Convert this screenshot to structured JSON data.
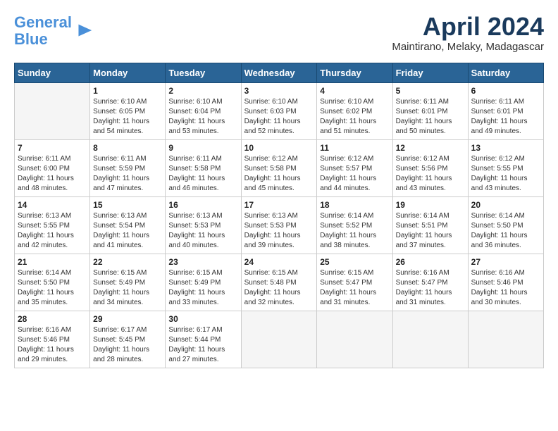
{
  "logo": {
    "line1": "General",
    "line2": "Blue"
  },
  "title": "April 2024",
  "subtitle": "Maintirano, Melaky, Madagascar",
  "weekdays": [
    "Sunday",
    "Monday",
    "Tuesday",
    "Wednesday",
    "Thursday",
    "Friday",
    "Saturday"
  ],
  "weeks": [
    [
      {
        "day": "",
        "info": ""
      },
      {
        "day": "1",
        "info": "Sunrise: 6:10 AM\nSunset: 6:05 PM\nDaylight: 11 hours\nand 54 minutes."
      },
      {
        "day": "2",
        "info": "Sunrise: 6:10 AM\nSunset: 6:04 PM\nDaylight: 11 hours\nand 53 minutes."
      },
      {
        "day": "3",
        "info": "Sunrise: 6:10 AM\nSunset: 6:03 PM\nDaylight: 11 hours\nand 52 minutes."
      },
      {
        "day": "4",
        "info": "Sunrise: 6:10 AM\nSunset: 6:02 PM\nDaylight: 11 hours\nand 51 minutes."
      },
      {
        "day": "5",
        "info": "Sunrise: 6:11 AM\nSunset: 6:01 PM\nDaylight: 11 hours\nand 50 minutes."
      },
      {
        "day": "6",
        "info": "Sunrise: 6:11 AM\nSunset: 6:01 PM\nDaylight: 11 hours\nand 49 minutes."
      }
    ],
    [
      {
        "day": "7",
        "info": "Sunrise: 6:11 AM\nSunset: 6:00 PM\nDaylight: 11 hours\nand 48 minutes."
      },
      {
        "day": "8",
        "info": "Sunrise: 6:11 AM\nSunset: 5:59 PM\nDaylight: 11 hours\nand 47 minutes."
      },
      {
        "day": "9",
        "info": "Sunrise: 6:11 AM\nSunset: 5:58 PM\nDaylight: 11 hours\nand 46 minutes."
      },
      {
        "day": "10",
        "info": "Sunrise: 6:12 AM\nSunset: 5:58 PM\nDaylight: 11 hours\nand 45 minutes."
      },
      {
        "day": "11",
        "info": "Sunrise: 6:12 AM\nSunset: 5:57 PM\nDaylight: 11 hours\nand 44 minutes."
      },
      {
        "day": "12",
        "info": "Sunrise: 6:12 AM\nSunset: 5:56 PM\nDaylight: 11 hours\nand 43 minutes."
      },
      {
        "day": "13",
        "info": "Sunrise: 6:12 AM\nSunset: 5:55 PM\nDaylight: 11 hours\nand 43 minutes."
      }
    ],
    [
      {
        "day": "14",
        "info": "Sunrise: 6:13 AM\nSunset: 5:55 PM\nDaylight: 11 hours\nand 42 minutes."
      },
      {
        "day": "15",
        "info": "Sunrise: 6:13 AM\nSunset: 5:54 PM\nDaylight: 11 hours\nand 41 minutes."
      },
      {
        "day": "16",
        "info": "Sunrise: 6:13 AM\nSunset: 5:53 PM\nDaylight: 11 hours\nand 40 minutes."
      },
      {
        "day": "17",
        "info": "Sunrise: 6:13 AM\nSunset: 5:53 PM\nDaylight: 11 hours\nand 39 minutes."
      },
      {
        "day": "18",
        "info": "Sunrise: 6:14 AM\nSunset: 5:52 PM\nDaylight: 11 hours\nand 38 minutes."
      },
      {
        "day": "19",
        "info": "Sunrise: 6:14 AM\nSunset: 5:51 PM\nDaylight: 11 hours\nand 37 minutes."
      },
      {
        "day": "20",
        "info": "Sunrise: 6:14 AM\nSunset: 5:50 PM\nDaylight: 11 hours\nand 36 minutes."
      }
    ],
    [
      {
        "day": "21",
        "info": "Sunrise: 6:14 AM\nSunset: 5:50 PM\nDaylight: 11 hours\nand 35 minutes."
      },
      {
        "day": "22",
        "info": "Sunrise: 6:15 AM\nSunset: 5:49 PM\nDaylight: 11 hours\nand 34 minutes."
      },
      {
        "day": "23",
        "info": "Sunrise: 6:15 AM\nSunset: 5:49 PM\nDaylight: 11 hours\nand 33 minutes."
      },
      {
        "day": "24",
        "info": "Sunrise: 6:15 AM\nSunset: 5:48 PM\nDaylight: 11 hours\nand 32 minutes."
      },
      {
        "day": "25",
        "info": "Sunrise: 6:15 AM\nSunset: 5:47 PM\nDaylight: 11 hours\nand 31 minutes."
      },
      {
        "day": "26",
        "info": "Sunrise: 6:16 AM\nSunset: 5:47 PM\nDaylight: 11 hours\nand 31 minutes."
      },
      {
        "day": "27",
        "info": "Sunrise: 6:16 AM\nSunset: 5:46 PM\nDaylight: 11 hours\nand 30 minutes."
      }
    ],
    [
      {
        "day": "28",
        "info": "Sunrise: 6:16 AM\nSunset: 5:46 PM\nDaylight: 11 hours\nand 29 minutes."
      },
      {
        "day": "29",
        "info": "Sunrise: 6:17 AM\nSunset: 5:45 PM\nDaylight: 11 hours\nand 28 minutes."
      },
      {
        "day": "30",
        "info": "Sunrise: 6:17 AM\nSunset: 5:44 PM\nDaylight: 11 hours\nand 27 minutes."
      },
      {
        "day": "",
        "info": ""
      },
      {
        "day": "",
        "info": ""
      },
      {
        "day": "",
        "info": ""
      },
      {
        "day": "",
        "info": ""
      }
    ]
  ]
}
